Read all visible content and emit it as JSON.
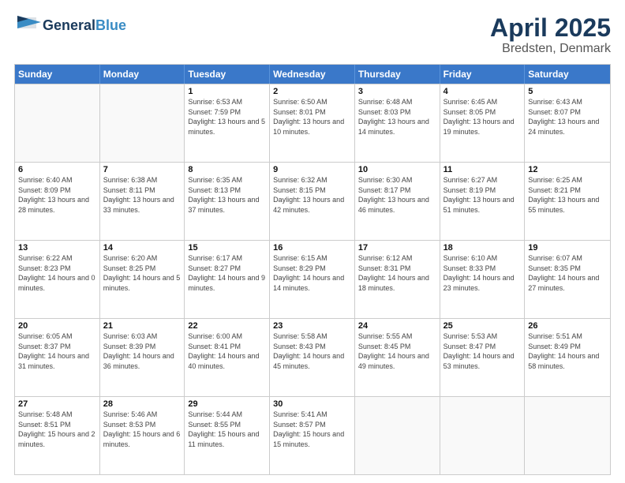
{
  "header": {
    "logo_line1": "General",
    "logo_line2": "Blue",
    "title": "April 2025",
    "subtitle": "Bredsten, Denmark"
  },
  "days_of_week": [
    "Sunday",
    "Monday",
    "Tuesday",
    "Wednesday",
    "Thursday",
    "Friday",
    "Saturday"
  ],
  "weeks": [
    [
      {
        "day": "",
        "sunrise": "",
        "sunset": "",
        "daylight": "",
        "empty": true
      },
      {
        "day": "",
        "sunrise": "",
        "sunset": "",
        "daylight": "",
        "empty": true
      },
      {
        "day": "1",
        "sunrise": "Sunrise: 6:53 AM",
        "sunset": "Sunset: 7:59 PM",
        "daylight": "Daylight: 13 hours and 5 minutes.",
        "empty": false
      },
      {
        "day": "2",
        "sunrise": "Sunrise: 6:50 AM",
        "sunset": "Sunset: 8:01 PM",
        "daylight": "Daylight: 13 hours and 10 minutes.",
        "empty": false
      },
      {
        "day": "3",
        "sunrise": "Sunrise: 6:48 AM",
        "sunset": "Sunset: 8:03 PM",
        "daylight": "Daylight: 13 hours and 14 minutes.",
        "empty": false
      },
      {
        "day": "4",
        "sunrise": "Sunrise: 6:45 AM",
        "sunset": "Sunset: 8:05 PM",
        "daylight": "Daylight: 13 hours and 19 minutes.",
        "empty": false
      },
      {
        "day": "5",
        "sunrise": "Sunrise: 6:43 AM",
        "sunset": "Sunset: 8:07 PM",
        "daylight": "Daylight: 13 hours and 24 minutes.",
        "empty": false
      }
    ],
    [
      {
        "day": "6",
        "sunrise": "Sunrise: 6:40 AM",
        "sunset": "Sunset: 8:09 PM",
        "daylight": "Daylight: 13 hours and 28 minutes.",
        "empty": false
      },
      {
        "day": "7",
        "sunrise": "Sunrise: 6:38 AM",
        "sunset": "Sunset: 8:11 PM",
        "daylight": "Daylight: 13 hours and 33 minutes.",
        "empty": false
      },
      {
        "day": "8",
        "sunrise": "Sunrise: 6:35 AM",
        "sunset": "Sunset: 8:13 PM",
        "daylight": "Daylight: 13 hours and 37 minutes.",
        "empty": false
      },
      {
        "day": "9",
        "sunrise": "Sunrise: 6:32 AM",
        "sunset": "Sunset: 8:15 PM",
        "daylight": "Daylight: 13 hours and 42 minutes.",
        "empty": false
      },
      {
        "day": "10",
        "sunrise": "Sunrise: 6:30 AM",
        "sunset": "Sunset: 8:17 PM",
        "daylight": "Daylight: 13 hours and 46 minutes.",
        "empty": false
      },
      {
        "day": "11",
        "sunrise": "Sunrise: 6:27 AM",
        "sunset": "Sunset: 8:19 PM",
        "daylight": "Daylight: 13 hours and 51 minutes.",
        "empty": false
      },
      {
        "day": "12",
        "sunrise": "Sunrise: 6:25 AM",
        "sunset": "Sunset: 8:21 PM",
        "daylight": "Daylight: 13 hours and 55 minutes.",
        "empty": false
      }
    ],
    [
      {
        "day": "13",
        "sunrise": "Sunrise: 6:22 AM",
        "sunset": "Sunset: 8:23 PM",
        "daylight": "Daylight: 14 hours and 0 minutes.",
        "empty": false
      },
      {
        "day": "14",
        "sunrise": "Sunrise: 6:20 AM",
        "sunset": "Sunset: 8:25 PM",
        "daylight": "Daylight: 14 hours and 5 minutes.",
        "empty": false
      },
      {
        "day": "15",
        "sunrise": "Sunrise: 6:17 AM",
        "sunset": "Sunset: 8:27 PM",
        "daylight": "Daylight: 14 hours and 9 minutes.",
        "empty": false
      },
      {
        "day": "16",
        "sunrise": "Sunrise: 6:15 AM",
        "sunset": "Sunset: 8:29 PM",
        "daylight": "Daylight: 14 hours and 14 minutes.",
        "empty": false
      },
      {
        "day": "17",
        "sunrise": "Sunrise: 6:12 AM",
        "sunset": "Sunset: 8:31 PM",
        "daylight": "Daylight: 14 hours and 18 minutes.",
        "empty": false
      },
      {
        "day": "18",
        "sunrise": "Sunrise: 6:10 AM",
        "sunset": "Sunset: 8:33 PM",
        "daylight": "Daylight: 14 hours and 23 minutes.",
        "empty": false
      },
      {
        "day": "19",
        "sunrise": "Sunrise: 6:07 AM",
        "sunset": "Sunset: 8:35 PM",
        "daylight": "Daylight: 14 hours and 27 minutes.",
        "empty": false
      }
    ],
    [
      {
        "day": "20",
        "sunrise": "Sunrise: 6:05 AM",
        "sunset": "Sunset: 8:37 PM",
        "daylight": "Daylight: 14 hours and 31 minutes.",
        "empty": false
      },
      {
        "day": "21",
        "sunrise": "Sunrise: 6:03 AM",
        "sunset": "Sunset: 8:39 PM",
        "daylight": "Daylight: 14 hours and 36 minutes.",
        "empty": false
      },
      {
        "day": "22",
        "sunrise": "Sunrise: 6:00 AM",
        "sunset": "Sunset: 8:41 PM",
        "daylight": "Daylight: 14 hours and 40 minutes.",
        "empty": false
      },
      {
        "day": "23",
        "sunrise": "Sunrise: 5:58 AM",
        "sunset": "Sunset: 8:43 PM",
        "daylight": "Daylight: 14 hours and 45 minutes.",
        "empty": false
      },
      {
        "day": "24",
        "sunrise": "Sunrise: 5:55 AM",
        "sunset": "Sunset: 8:45 PM",
        "daylight": "Daylight: 14 hours and 49 minutes.",
        "empty": false
      },
      {
        "day": "25",
        "sunrise": "Sunrise: 5:53 AM",
        "sunset": "Sunset: 8:47 PM",
        "daylight": "Daylight: 14 hours and 53 minutes.",
        "empty": false
      },
      {
        "day": "26",
        "sunrise": "Sunrise: 5:51 AM",
        "sunset": "Sunset: 8:49 PM",
        "daylight": "Daylight: 14 hours and 58 minutes.",
        "empty": false
      }
    ],
    [
      {
        "day": "27",
        "sunrise": "Sunrise: 5:48 AM",
        "sunset": "Sunset: 8:51 PM",
        "daylight": "Daylight: 15 hours and 2 minutes.",
        "empty": false
      },
      {
        "day": "28",
        "sunrise": "Sunrise: 5:46 AM",
        "sunset": "Sunset: 8:53 PM",
        "daylight": "Daylight: 15 hours and 6 minutes.",
        "empty": false
      },
      {
        "day": "29",
        "sunrise": "Sunrise: 5:44 AM",
        "sunset": "Sunset: 8:55 PM",
        "daylight": "Daylight: 15 hours and 11 minutes.",
        "empty": false
      },
      {
        "day": "30",
        "sunrise": "Sunrise: 5:41 AM",
        "sunset": "Sunset: 8:57 PM",
        "daylight": "Daylight: 15 hours and 15 minutes.",
        "empty": false
      },
      {
        "day": "",
        "sunrise": "",
        "sunset": "",
        "daylight": "",
        "empty": true
      },
      {
        "day": "",
        "sunrise": "",
        "sunset": "",
        "daylight": "",
        "empty": true
      },
      {
        "day": "",
        "sunrise": "",
        "sunset": "",
        "daylight": "",
        "empty": true
      }
    ]
  ]
}
